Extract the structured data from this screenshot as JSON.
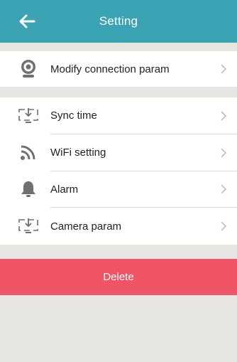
{
  "header": {
    "title": "Setting",
    "back_icon": "arrow-left-icon",
    "color": "#3aa3b4"
  },
  "section1": {
    "items": [
      {
        "label": "Modify connection param",
        "icon": "webcam-icon"
      }
    ]
  },
  "section2": {
    "items": [
      {
        "label": "Sync time",
        "icon": "monitor-download-icon"
      },
      {
        "label": "WiFi setting",
        "icon": "wifi-signal-icon"
      },
      {
        "label": "Alarm",
        "icon": "bell-icon"
      },
      {
        "label": "Camera param",
        "icon": "monitor-download-icon"
      }
    ]
  },
  "delete": {
    "label": "Delete",
    "color": "#ef5566"
  }
}
